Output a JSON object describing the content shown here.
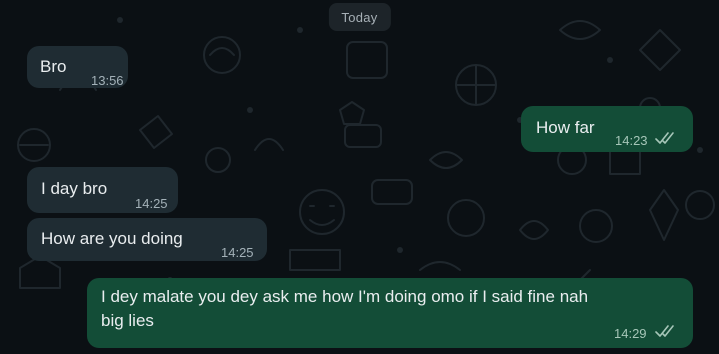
{
  "chat": {
    "date_separator": "Today",
    "messages": [
      {
        "direction": "incoming",
        "text": "Bro",
        "time": "13:56"
      },
      {
        "direction": "outgoing",
        "text": "How far",
        "time": "14:23",
        "status": "double-check-icon"
      },
      {
        "direction": "incoming",
        "text": "I day bro",
        "time": "14:25"
      },
      {
        "direction": "incoming",
        "text": "How are you doing",
        "time": "14:25"
      },
      {
        "direction": "outgoing",
        "text_line1": "I dey malate you dey ask me how I'm doing omo if I said fine nah",
        "text_line2": "big lies",
        "time": "14:29",
        "status": "double-check-icon"
      }
    ]
  },
  "colors": {
    "background": "#0b1014",
    "incoming_bubble": "#1f2c33",
    "outgoing_bubble": "#134d37",
    "text": "#e9edef",
    "date_pill": "#1d2429"
  }
}
